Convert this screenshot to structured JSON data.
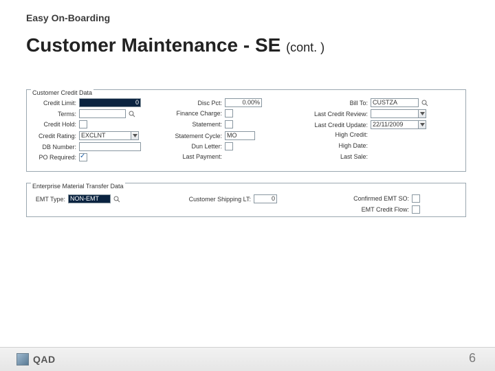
{
  "header": {
    "topic": "Easy On-Boarding",
    "title_main": "Customer Maintenance - SE",
    "title_cont": "(cont. )"
  },
  "credit": {
    "legend": "Customer Credit Data",
    "credit_limit": {
      "label": "Credit Limit:",
      "value": "0"
    },
    "terms": {
      "label": "Terms:",
      "value": ""
    },
    "credit_hold": {
      "label": "Credit Hold:",
      "checked": false
    },
    "credit_rating": {
      "label": "Credit Rating:",
      "value": "EXCLNT"
    },
    "db_number": {
      "label": "DB Number:",
      "value": ""
    },
    "po_required": {
      "label": "PO Required:",
      "checked": true
    },
    "disc_pct": {
      "label": "Disc Pct:",
      "value": "0.00%"
    },
    "finance_charge": {
      "label": "Finance Charge:",
      "checked": false
    },
    "statement": {
      "label": "Statement:",
      "checked": false
    },
    "statement_cycle": {
      "label": "Statement Cycle:",
      "value": "MO"
    },
    "dun_letter": {
      "label": "Dun Letter:",
      "checked": false
    },
    "last_payment": {
      "label": "Last Payment:",
      "value": ""
    },
    "bill_to": {
      "label": "Bill To:",
      "value": "CUSTZA"
    },
    "last_credit_review": {
      "label": "Last Credit Review:",
      "value": ""
    },
    "last_credit_update": {
      "label": "Last Credit Update:",
      "value": "22/11/2009"
    },
    "high_credit": {
      "label": "High Credit:",
      "value": ""
    },
    "high_date": {
      "label": "High Date:",
      "value": ""
    },
    "last_sale": {
      "label": "Last Sale:",
      "value": ""
    }
  },
  "emt": {
    "legend": "Enterprise Material Transfer Data",
    "emt_type": {
      "label": "EMT Type:",
      "value": "NON-EMT"
    },
    "cust_ship_lt": {
      "label": "Customer Shipping LT:",
      "value": "0"
    },
    "confirmed_emt_so": {
      "label": "Confirmed EMT SO:",
      "checked": false
    },
    "emt_credit_flow": {
      "label": "EMT Credit Flow:",
      "checked": false
    }
  },
  "footer": {
    "brand": "QAD",
    "page": "6"
  }
}
